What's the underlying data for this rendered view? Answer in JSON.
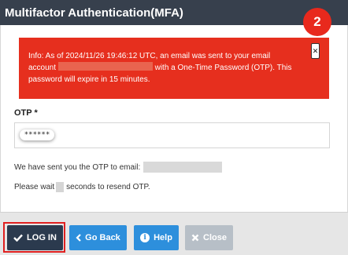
{
  "window": {
    "title": "Multifactor Authentication(MFA)"
  },
  "step_badge": "2",
  "alert": {
    "line1": "Info: As of 2024/11/26 19:46:12 UTC, an email was sent to your email",
    "line2_prefix": "account",
    "line2_suffix": "with a One-Time Password (OTP). This",
    "line3": "password will expire in 15 minutes.",
    "close_glyph": "✕",
    "color": "#e62f1e"
  },
  "otp": {
    "label": "OTP *",
    "value": "******"
  },
  "messages": {
    "sent_text": "We have sent you the OTP to email:",
    "wait_prefix": "Please wait",
    "wait_suffix": "seconds to resend OTP."
  },
  "buttons": {
    "login": {
      "label": "LOG IN",
      "icon": "check-icon",
      "color": "#2b3a4e"
    },
    "back": {
      "label": "Go Back",
      "icon": "chevron-left-icon",
      "color": "#2d8fdc"
    },
    "help": {
      "label": "Help",
      "icon": "info-icon",
      "color": "#2d8fdc"
    },
    "close": {
      "label": "Close",
      "icon": "close-icon",
      "color": "#b7bfc7"
    }
  }
}
